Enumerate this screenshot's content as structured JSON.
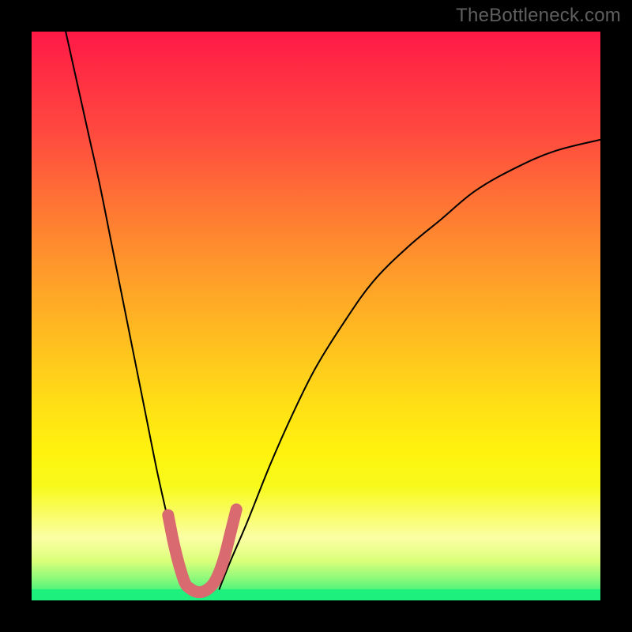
{
  "watermark": {
    "text": "TheBottleneck.com"
  },
  "chart_data": {
    "type": "line",
    "title": "",
    "xlabel": "",
    "ylabel": "",
    "xlim": [
      0,
      100
    ],
    "ylim": [
      0,
      100
    ],
    "grid": false,
    "legend": false,
    "gradient_stops": [
      {
        "pos": 0,
        "color": "#ff1846"
      },
      {
        "pos": 18,
        "color": "#ff4a3f"
      },
      {
        "pos": 44,
        "color": "#ffa029"
      },
      {
        "pos": 66,
        "color": "#ffe015"
      },
      {
        "pos": 89,
        "color": "#fbffa5"
      },
      {
        "pos": 100,
        "color": "#1ef07e"
      }
    ],
    "series": [
      {
        "name": "left-branch",
        "x": [
          6,
          8,
          10,
          12,
          14,
          16,
          18,
          20,
          22,
          24,
          25,
          26,
          27
        ],
        "values": [
          100,
          91,
          82,
          73,
          63,
          53,
          43,
          33,
          23,
          14,
          9,
          5,
          2
        ]
      },
      {
        "name": "right-branch",
        "x": [
          33,
          35,
          38,
          42,
          46,
          50,
          55,
          60,
          66,
          72,
          78,
          85,
          92,
          100
        ],
        "values": [
          2,
          7,
          14,
          24,
          33,
          41,
          49,
          56,
          62,
          67,
          72,
          76,
          79,
          81
        ]
      },
      {
        "name": "valley-accent",
        "x": [
          24,
          25,
          26,
          27,
          28,
          29,
          30,
          31,
          32,
          33,
          34,
          35,
          36
        ],
        "values": [
          15,
          10,
          6,
          3,
          2,
          1.5,
          1.5,
          2,
          3,
          5,
          8,
          12,
          16
        ]
      }
    ],
    "valley_min_x": 30,
    "valley_min_y": 1.5
  }
}
